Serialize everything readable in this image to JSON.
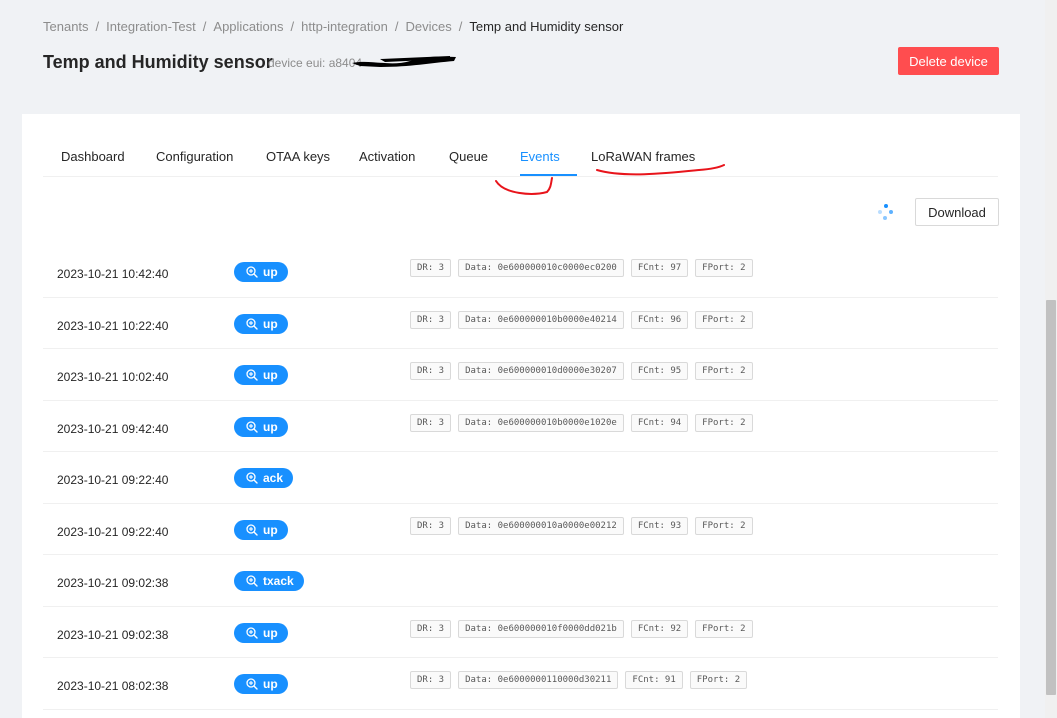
{
  "breadcrumb": {
    "items": [
      "Tenants",
      "Integration-Test",
      "Applications",
      "http-integration",
      "Devices",
      "Temp and Humidity sensor"
    ],
    "separator": "/"
  },
  "header": {
    "title": "Temp and Humidity sensor",
    "device_eui_label": "device eui: a8404",
    "delete_label": "Delete device"
  },
  "tabs": [
    {
      "label": "Dashboard"
    },
    {
      "label": "Configuration"
    },
    {
      "label": "OTAA keys"
    },
    {
      "label": "Activation"
    },
    {
      "label": "Queue"
    },
    {
      "label": "Events",
      "active": true
    },
    {
      "label": "LoRaWAN frames"
    }
  ],
  "toolbar": {
    "download_label": "Download"
  },
  "events": [
    {
      "time": "2023-10-21 10:42:40",
      "type": "up",
      "fields": [
        "DR: 3",
        "Data: 0e600000010c0000ec0200",
        "FCnt: 97",
        "FPort: 2"
      ]
    },
    {
      "time": "2023-10-21 10:22:40",
      "type": "up",
      "fields": [
        "DR: 3",
        "Data: 0e600000010b0000e40214",
        "FCnt: 96",
        "FPort: 2"
      ]
    },
    {
      "time": "2023-10-21 10:02:40",
      "type": "up",
      "fields": [
        "DR: 3",
        "Data: 0e600000010d0000e30207",
        "FCnt: 95",
        "FPort: 2"
      ]
    },
    {
      "time": "2023-10-21 09:42:40",
      "type": "up",
      "fields": [
        "DR: 3",
        "Data: 0e600000010b0000e1020e",
        "FCnt: 94",
        "FPort: 2"
      ]
    },
    {
      "time": "2023-10-21 09:22:40",
      "type": "ack",
      "fields": []
    },
    {
      "time": "2023-10-21 09:22:40",
      "type": "up",
      "fields": [
        "DR: 3",
        "Data: 0e600000010a0000e00212",
        "FCnt: 93",
        "FPort: 2"
      ]
    },
    {
      "time": "2023-10-21 09:02:38",
      "type": "txack",
      "fields": []
    },
    {
      "time": "2023-10-21 09:02:38",
      "type": "up",
      "fields": [
        "DR: 3",
        "Data: 0e600000010f0000dd021b",
        "FCnt: 92",
        "FPort: 2"
      ]
    },
    {
      "time": "2023-10-21 08:02:38",
      "type": "up",
      "fields": [
        "DR: 3",
        "Data: 0e6000000110000d30211",
        "FCnt: 91",
        "FPort: 2"
      ]
    }
  ],
  "icons": {
    "event_tag": "zoom-in-icon",
    "loading": "loading-spinner-icon"
  },
  "colors": {
    "primary": "#1890ff",
    "danger": "#ff4d4f",
    "annotation": "#e8141b"
  }
}
